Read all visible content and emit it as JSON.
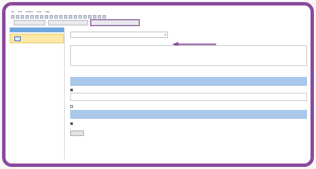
{
  "menu": [
    "File",
    "Edit",
    "Sidebar",
    "View",
    "Help"
  ],
  "tabs": [
    "",
    "",
    ""
  ],
  "sidebar": {
    "selected_item_label": "",
    "second_item_label": "",
    "second_item_count": ""
  },
  "main": {
    "field1_label": "",
    "dropdown_value": "",
    "description_label": "",
    "description_text": "",
    "section_label": "",
    "blue_bar1_text": "",
    "checkbox1_label": "",
    "answer_text": "",
    "checkbox2_label": "",
    "blue_bar2_text": "",
    "checkbox3_label": "",
    "button_label": ""
  },
  "colors": {
    "frame": "#8a4a9c",
    "accent_blue": "#6fa6e0",
    "highlight_bar": "#a9c8ea",
    "selected_item": "#fde8a5",
    "arrow": "#8a4a9c"
  }
}
